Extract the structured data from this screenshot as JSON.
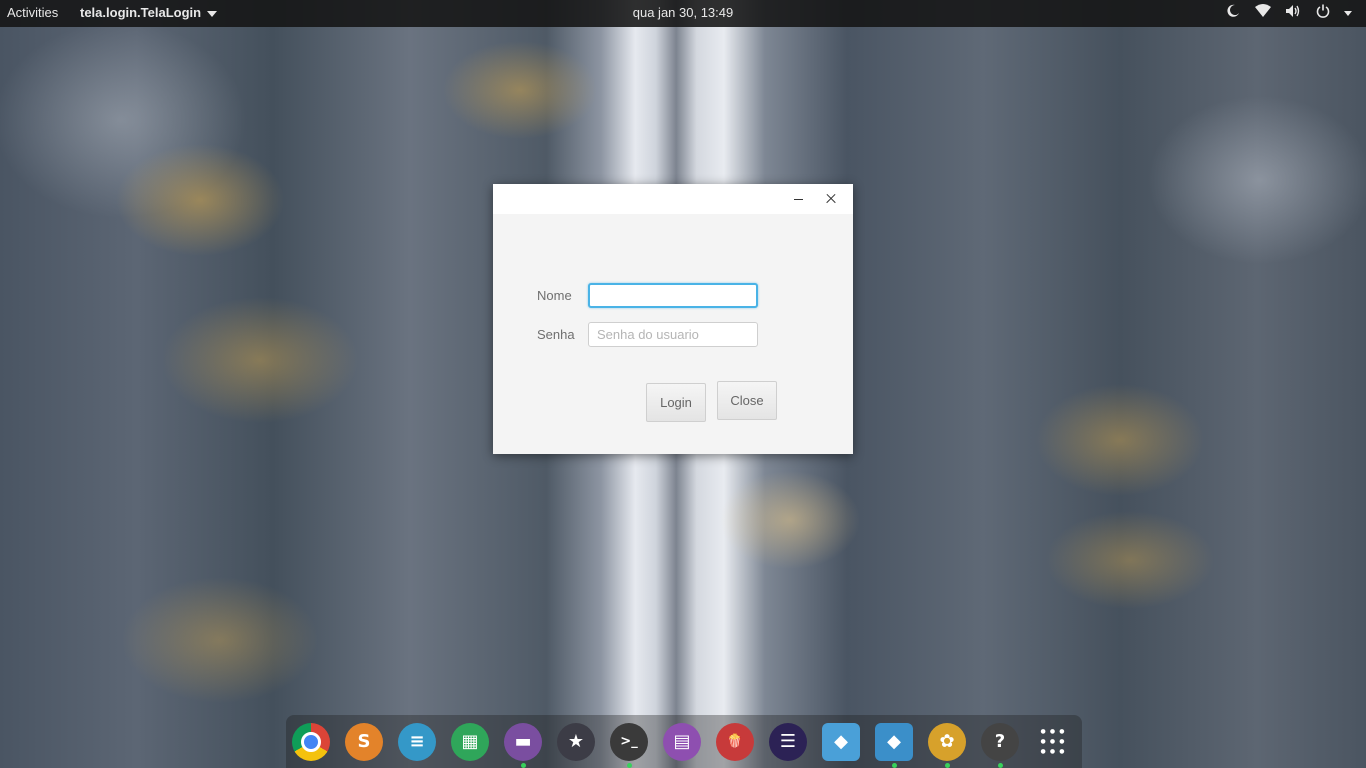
{
  "topbar": {
    "activities": "Activities",
    "app_menu": "tela.login.TelaLogin",
    "clock": "qua jan 30, 13:49",
    "tray_icons": [
      "night-light-icon",
      "wifi-icon",
      "volume-icon",
      "power-icon"
    ]
  },
  "dialog": {
    "nome_label": "Nome",
    "nome_value": "",
    "senha_label": "Senha",
    "senha_placeholder": "Senha do usuario",
    "login_label": "Login",
    "close_label": "Close"
  },
  "dock": {
    "apps": [
      {
        "icon": "chrome-icon",
        "glyph": "",
        "color": "#db4437",
        "running": false
      },
      {
        "icon": "sublime-text-icon",
        "glyph": "S",
        "color": "#e3832a",
        "running": false
      },
      {
        "icon": "text-editor-icon",
        "glyph": "≡",
        "color": "#3498c8",
        "running": false
      },
      {
        "icon": "spreadsheet-icon",
        "glyph": "▦",
        "color": "#2fa65a",
        "running": false
      },
      {
        "icon": "files-icon",
        "glyph": "▬",
        "color": "#7a4ea0",
        "running": true
      },
      {
        "icon": "bookmark-app-icon",
        "glyph": "★",
        "color": "#3c3c46",
        "running": false
      },
      {
        "icon": "terminal-icon",
        "glyph": ">_",
        "color": "#3a3a3a",
        "running": true
      },
      {
        "icon": "document-viewer-icon",
        "glyph": "▤",
        "color": "#8e4fb0",
        "running": false
      },
      {
        "icon": "popcorn-time-icon",
        "glyph": "🍿",
        "color": "#c73a3a",
        "running": false
      },
      {
        "icon": "eclipse-icon",
        "glyph": "☰",
        "color": "#2c2255",
        "running": false
      },
      {
        "icon": "virtualbox-icon",
        "glyph": "◆",
        "color": "#4aa0d8",
        "running": false
      },
      {
        "icon": "virtualbox-vm-icon",
        "glyph": "◆",
        "color": "#3b8fc9",
        "running": true
      },
      {
        "icon": "mysql-workbench-icon",
        "glyph": "✿",
        "color": "#d7a12b",
        "running": true
      },
      {
        "icon": "unknown-app-icon",
        "glyph": "?",
        "color": "#444444",
        "running": true
      },
      {
        "icon": "show-applications-icon",
        "glyph": "⋮⋮⋮",
        "color": "transparent",
        "running": false
      }
    ]
  }
}
